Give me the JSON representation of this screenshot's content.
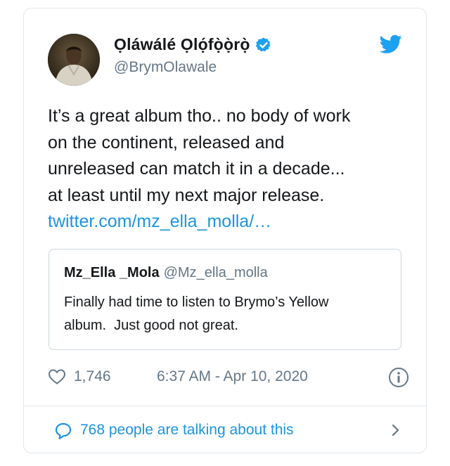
{
  "tweet": {
    "display_name": "Ọláwálé Ọlọ́fọ̀ọ̀rọ̀",
    "handle": "@BrymOlawale",
    "text_lines": [
      "It’s a great album tho.. no body of work",
      "on the continent, released and",
      "unreleased can match it in a decade...",
      "at least until my next major release."
    ],
    "link": "twitter.com/mz_ella_molla/…",
    "likes": "1,746",
    "timestamp": "6:37 AM - Apr 10, 2020",
    "talking": "768 people are talking about this"
  },
  "quote": {
    "name": "Mz_Ella _Mola",
    "handle": "@Mz_ella_molla",
    "text_lines": [
      "Finally had time to listen to Brymo’s Yellow",
      "album.  Just good not great."
    ]
  },
  "colors": {
    "link": "#1b95e0",
    "muted": "#657786",
    "text": "#14171a",
    "border": "#e1e8ed"
  },
  "icons": [
    "verified-badge-icon",
    "twitter-bird-icon",
    "heart-icon",
    "info-icon",
    "speech-bubble-icon",
    "chevron-right-icon"
  ]
}
